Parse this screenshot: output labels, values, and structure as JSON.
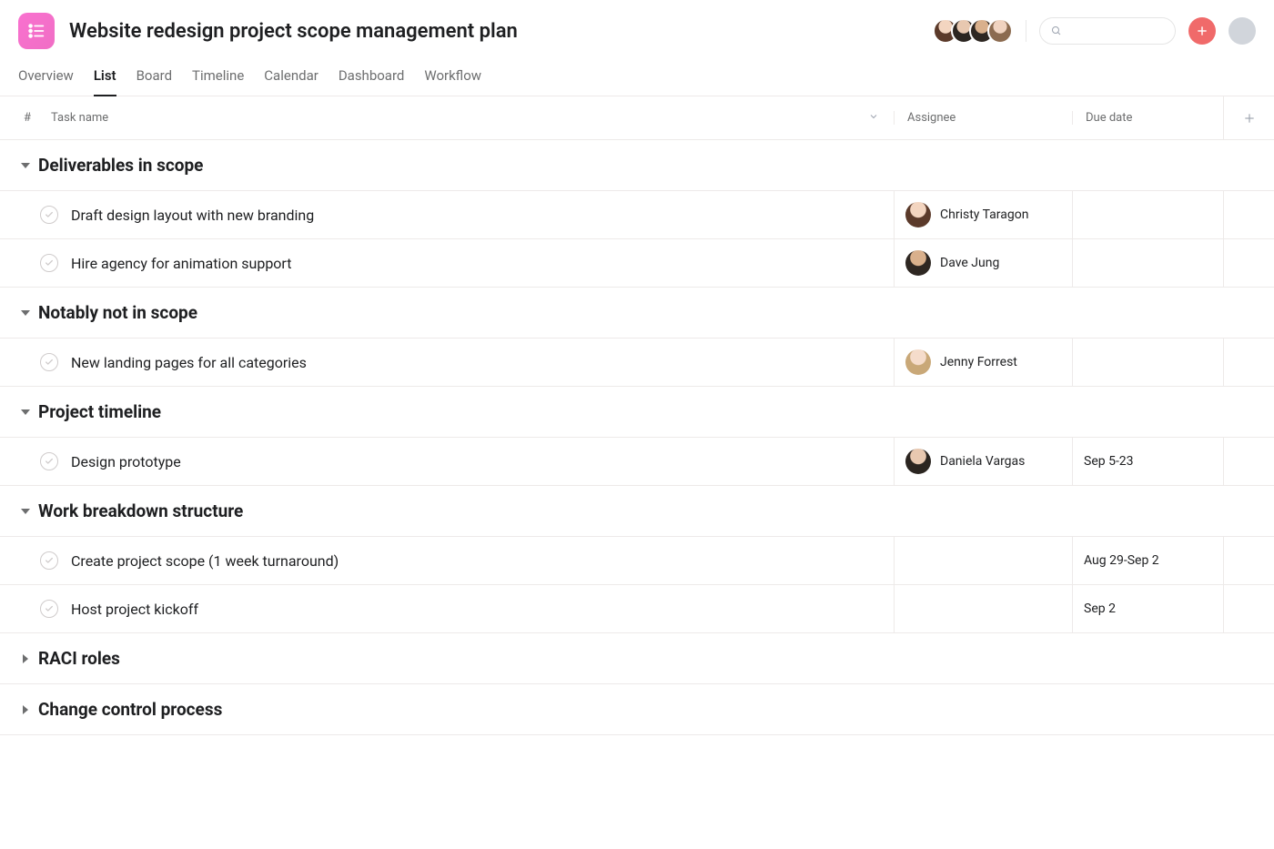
{
  "project": {
    "title": "Website redesign project scope management plan"
  },
  "tabs": [
    {
      "label": "Overview",
      "active": false
    },
    {
      "label": "List",
      "active": true
    },
    {
      "label": "Board",
      "active": false
    },
    {
      "label": "Timeline",
      "active": false
    },
    {
      "label": "Calendar",
      "active": false
    },
    {
      "label": "Dashboard",
      "active": false
    },
    {
      "label": "Workflow",
      "active": false
    }
  ],
  "columns": {
    "number": "#",
    "task": "Task name",
    "assignee": "Assignee",
    "due": "Due date"
  },
  "sections": [
    {
      "title": "Deliverables in scope",
      "expanded": true,
      "tasks": [
        {
          "name": "Draft design layout with new branding",
          "assignee": "Christy Taragon",
          "avatar": "av-f1",
          "due": ""
        },
        {
          "name": "Hire agency for animation support",
          "assignee": "Dave Jung",
          "avatar": "av-m1",
          "due": ""
        }
      ]
    },
    {
      "title": "Notably not in scope",
      "expanded": true,
      "tasks": [
        {
          "name": "New landing pages for all categories",
          "assignee": "Jenny Forrest",
          "avatar": "av-fblonde",
          "due": ""
        }
      ]
    },
    {
      "title": "Project timeline",
      "expanded": true,
      "tasks": [
        {
          "name": "Design prototype",
          "assignee": "Daniela Vargas",
          "avatar": "av-f2",
          "due": "Sep 5-23"
        }
      ]
    },
    {
      "title": "Work breakdown structure",
      "expanded": true,
      "tasks": [
        {
          "name": "Create project scope (1 week turnaround)",
          "assignee": "",
          "avatar": "",
          "due": "Aug 29-Sep 2"
        },
        {
          "name": "Host project kickoff",
          "assignee": "",
          "avatar": "",
          "due": "Sep 2"
        }
      ]
    },
    {
      "title": "RACI roles",
      "expanded": false,
      "tasks": []
    },
    {
      "title": "Change control process",
      "expanded": false,
      "tasks": []
    }
  ]
}
